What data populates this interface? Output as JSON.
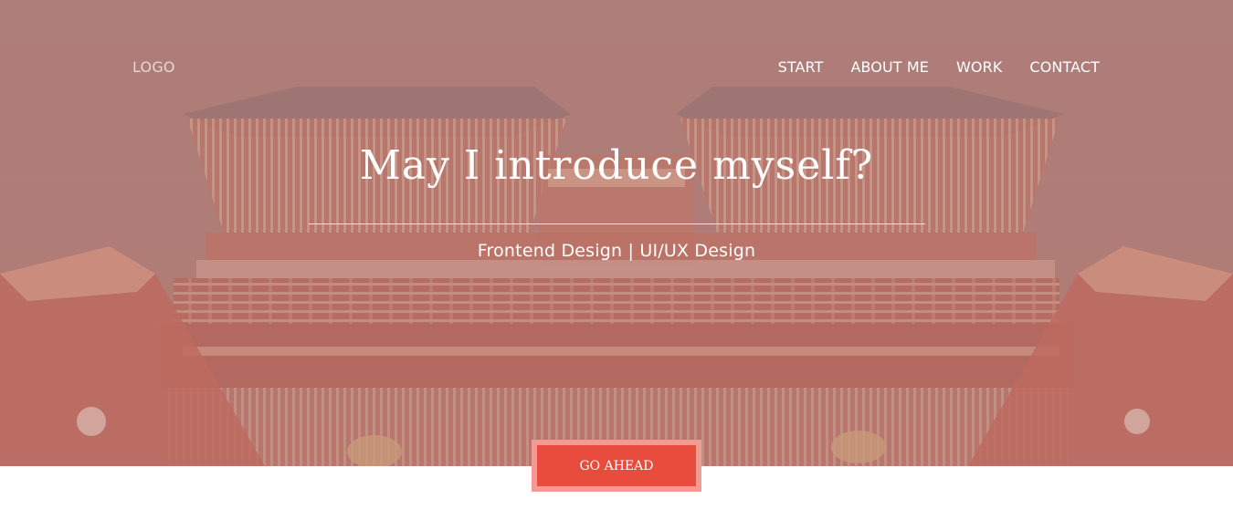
{
  "header": {
    "logo_text": "LOGO",
    "nav": [
      {
        "label": "START"
      },
      {
        "label": "ABOUT ME"
      },
      {
        "label": "WORK"
      },
      {
        "label": "CONTACT"
      }
    ]
  },
  "hero": {
    "title": "May I introduce myself?",
    "subtitle": "Frontend Design | UI/UX Design",
    "cta_label": "GO AHEAD"
  },
  "colors": {
    "accent": "#e74c3c",
    "accent_border": "#f39a92",
    "overlay": "#b47c78",
    "text_on_hero": "#ffffff"
  }
}
